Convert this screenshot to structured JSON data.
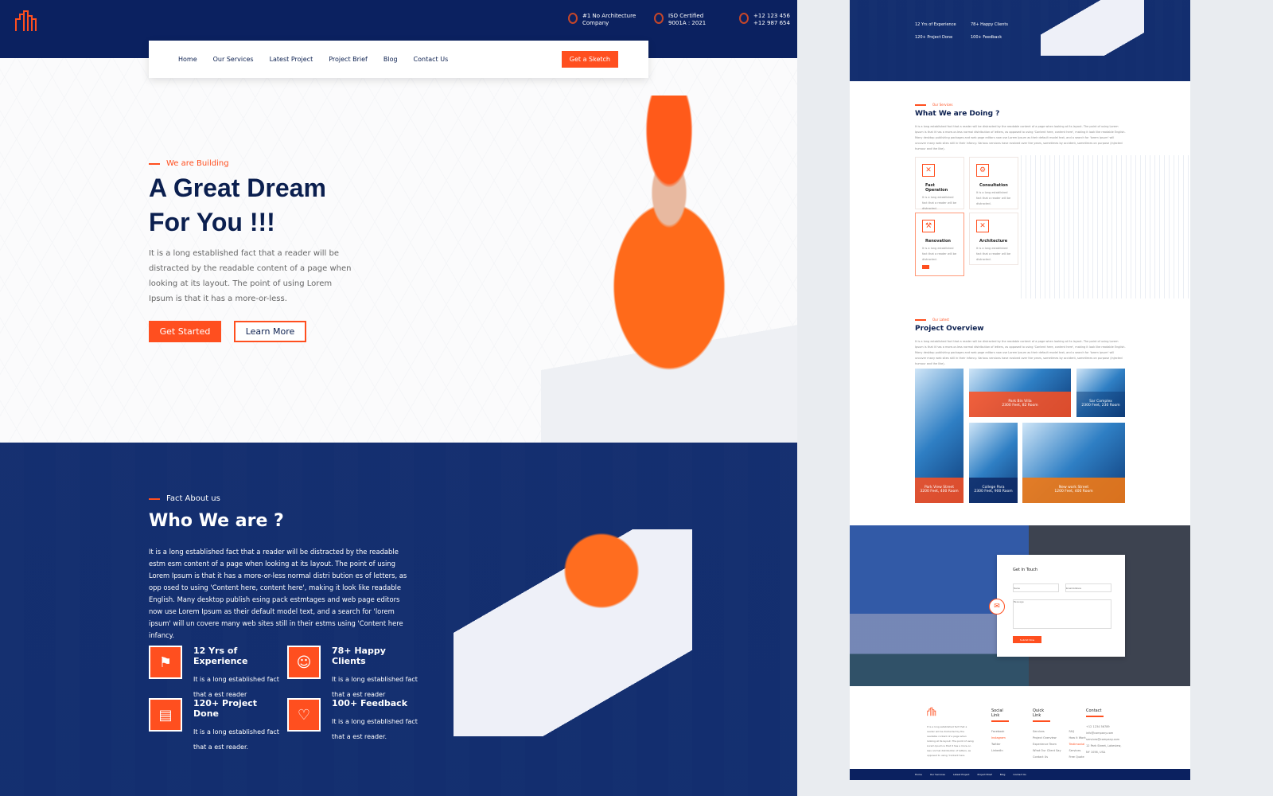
{
  "colors": {
    "navy": "#0b2160",
    "accent": "#ff4f1f"
  },
  "header": {
    "info": [
      {
        "icon": "trophy-icon",
        "line1": "#1 No Architecture",
        "line2": "Company"
      },
      {
        "icon": "certificate-icon",
        "line1": "ISO Certified",
        "line2": "9001A : 2021"
      },
      {
        "icon": "phone-icon",
        "line1": "+12 123 456",
        "line2": "+12 987 654"
      }
    ],
    "nav": [
      "Home",
      "Our Services",
      "Latest Project",
      "Project Brief",
      "Blog",
      "Contact Us"
    ],
    "cta": "Get a Sketch"
  },
  "hero": {
    "kicker": "We are Building",
    "title1": "A Great Dream",
    "title2": "For You !!!",
    "text": "It is a long established fact that a reader will be distracted by the readable content of a page when looking at its layout. The point of using Lorem Ipsum is that it has a more-or-less.",
    "primary": "Get Started",
    "secondary": "Learn More"
  },
  "about": {
    "kicker": "Fact About us",
    "title": "Who We are ?",
    "text": "It is a long established fact that a reader will be distracted by the readable estm esm content of a page when looking at its layout. The point of using Lorem Ipsum is that it has a more-or-less normal distri bution es of letters, as opp osed to using 'Content here, content here', making  it look like readable English. Many desktop publish esing pack estmtages and web page editors now use Lorem Ipsum as their default model text, and a search for 'lorem ipsum' will un covere many web sites still in their  estms using 'Content here infancy.",
    "stats": [
      {
        "icon": "stairs-flag-icon",
        "title": "12 Yrs of Experience",
        "text": "It is a long established fact that a est reader"
      },
      {
        "icon": "smiley-icon",
        "title": "78+ Happy Clients",
        "text": "It is a long established fact that a est reader"
      },
      {
        "icon": "blueprint-icon",
        "title": "120+ Project Done",
        "text": "It is a long established fact that a est reader."
      },
      {
        "icon": "chat-heart-icon",
        "title": "100+ Feedback",
        "text": "It is a long established fact that a est reader."
      }
    ]
  },
  "services": {
    "kicker": "Our Services",
    "title": "What We are Doing ?",
    "text": "It is a long established fact that a reader will be distracted by the readable content of a page when looking at its layout. The point of using Lorem Ipsum is that it has a more-or-less normal distribution of letters, as opposed to using 'Content here, content here', making it look like readable English. Many desktop publishing packages and web page editors now use Lorem Ipsum as their default model text, and a search for 'lorem ipsum' will uncover many web sites still in their infancy. Various versions have evolved over the years, sometimes by accident, sometimes on purpose (injected humour and the like).",
    "cards": [
      {
        "title": "Fast Operation",
        "text": "It is a long established fact that a reader will be distracted."
      },
      {
        "title": "Consultation",
        "text": "It is a long established fact that a reader will be distracted."
      },
      {
        "title": "Renovation",
        "text": "It is a long established fact that a reader will be distracted."
      },
      {
        "title": "Architecture",
        "text": "It is a long established fact that a reader will be distracted."
      }
    ]
  },
  "projects": {
    "kicker": "Our Latest",
    "title": "Project Overview",
    "text": "It is a long established fact that a reader will be distracted by the readable content of a page when looking at its layout. The point of using Lorem Ipsum is that it has a more-or-less normal distribution of letters, as opposed to using 'Content here, content here', making it look like readable English. Many desktop publishing packages and web page editors now use Lorem Ipsum as their default model text, and a search for 'lorem ipsum' will uncover many web sites still in their infancy. Various versions have evolved over the years, sometimes by accident, sometimes on purpose (injected humour and the like).",
    "items": [
      {
        "name": "Park Bin Villa",
        "meta": "2300 Feet, 82 Room"
      },
      {
        "name": "Sar Complex",
        "meta": "2300 Feet, 230 Room"
      },
      {
        "name": "Park View Street",
        "meta": "3200 Feet, 400 Room"
      },
      {
        "name": "College Para",
        "meta": "2300 Feet, 900 Room"
      },
      {
        "name": "New work Street",
        "meta": "1200 Feet, 400 Room"
      }
    ]
  },
  "contact": {
    "title": "Get In Touch",
    "name_ph": "Name",
    "email_ph": "Email Address",
    "message_ph": "Message",
    "submit": "Submit Now"
  },
  "footer": {
    "about": "It is a long established fact that a reader will be distracted by the readable content of a page when looking at its layout. The point of using Lorem Ipsum is that it has a more-or-less normal distribution of letters, as opposed to using 'Content here.",
    "social_title": "Social Link",
    "social": [
      "Facebook",
      "Instagram",
      "Twitter",
      "LinkedIn"
    ],
    "quick_title": "Quick Link",
    "quick1": [
      "Services",
      "Project Overview",
      "Experience Team",
      "What Our Client Say",
      "Contact Us"
    ],
    "quick2": [
      "FAQ",
      "How it Work",
      "Testimonial",
      "Services",
      "Free Quote"
    ],
    "contact_title": "Contact",
    "contact": [
      "+12 1234 56789",
      "info@company.com",
      "services@company.com",
      "12 Park Street, Lakeview,",
      "NY 1056, USA"
    ],
    "bottom_nav": [
      "Home",
      "Our Services",
      "Latest Project",
      "Project Brief",
      "Blog",
      "Contact Us"
    ]
  }
}
